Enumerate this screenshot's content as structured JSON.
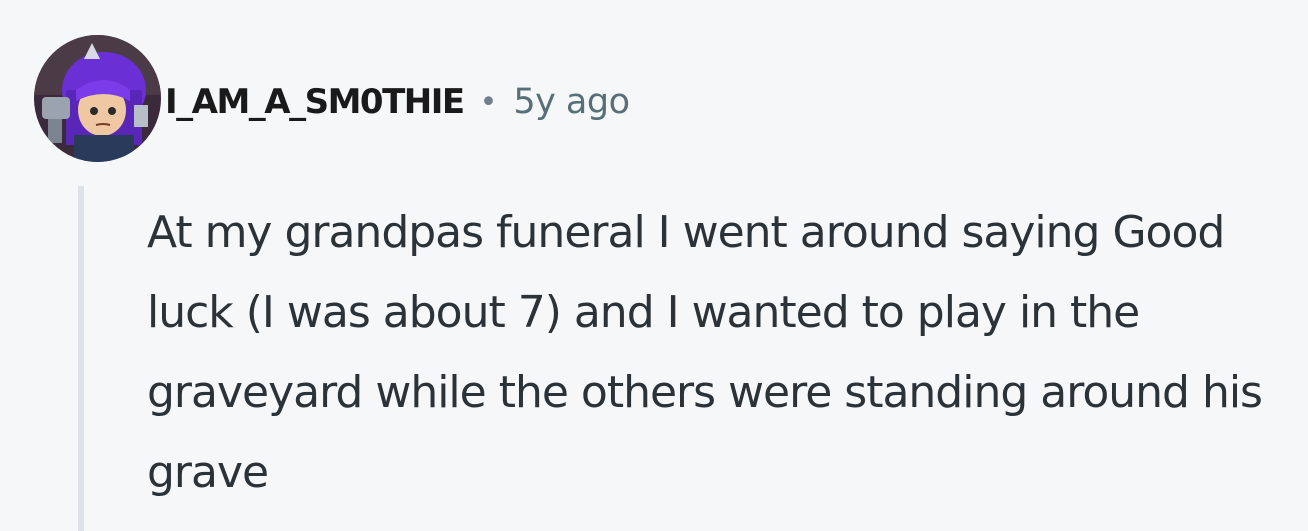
{
  "comment": {
    "author": "I_AM_A_SM0THIE",
    "separator": "•",
    "timestamp": "5y ago",
    "avatar_icon": "user-avatar-icon",
    "body": "At my grandpas funeral I went around saying Good luck (I was about 7) and I wanted to play in the graveyard while the others were standing around his grave"
  },
  "colors": {
    "background": "#f6f7f9",
    "author": "#1a1a1b",
    "meta": "#576f76",
    "body_text": "#2c3338",
    "thread_line": "#dde2e8"
  }
}
